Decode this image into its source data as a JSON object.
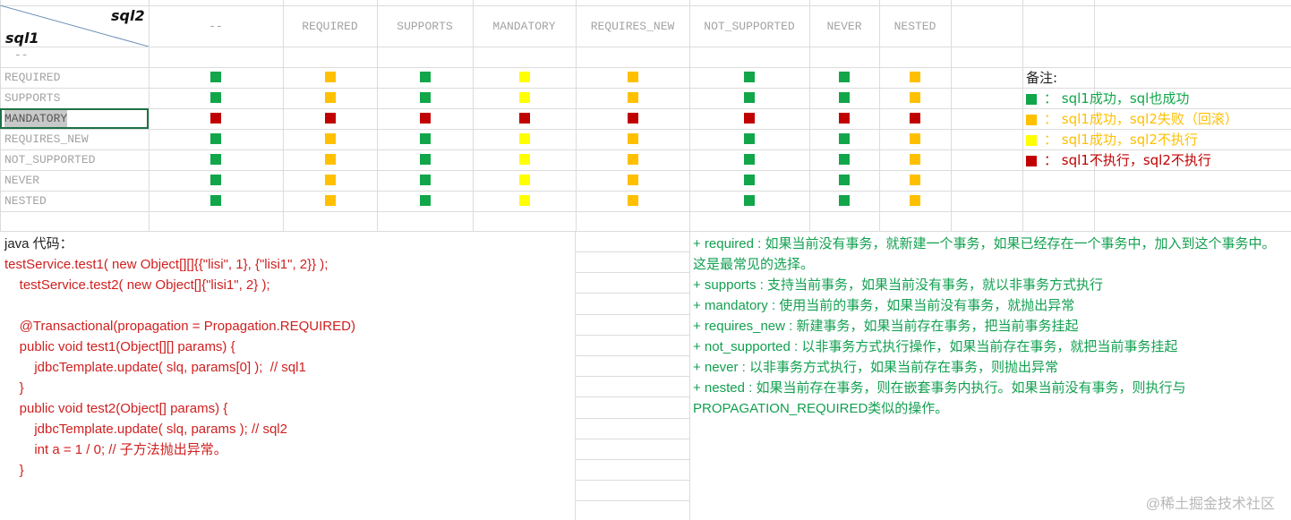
{
  "corner": {
    "col_axis": "sql2",
    "row_axis": "sql1"
  },
  "columns": [
    "--",
    "REQUIRED",
    "SUPPORTS",
    "MANDATORY",
    "REQUIRES_NEW",
    "NOT_SUPPORTED",
    "NEVER",
    "NESTED"
  ],
  "first_row_label": "--",
  "rows": [
    {
      "label": "REQUIRED",
      "cells": [
        "green",
        "orange",
        "green",
        "yellow",
        "orange",
        "green",
        "green",
        "orange"
      ]
    },
    {
      "label": "SUPPORTS",
      "cells": [
        "green",
        "orange",
        "green",
        "yellow",
        "orange",
        "green",
        "green",
        "orange"
      ]
    },
    {
      "label": "MANDATORY",
      "cells": [
        "red",
        "red",
        "red",
        "red",
        "red",
        "red",
        "red",
        "red"
      ]
    },
    {
      "label": "REQUIRES_NEW",
      "cells": [
        "green",
        "orange",
        "green",
        "yellow",
        "orange",
        "green",
        "green",
        "orange"
      ]
    },
    {
      "label": "NOT_SUPPORTED",
      "cells": [
        "green",
        "orange",
        "green",
        "yellow",
        "orange",
        "green",
        "green",
        "orange"
      ]
    },
    {
      "label": "NEVER",
      "cells": [
        "green",
        "orange",
        "green",
        "yellow",
        "orange",
        "green",
        "green",
        "orange"
      ]
    },
    {
      "label": "NESTED",
      "cells": [
        "green",
        "orange",
        "green",
        "yellow",
        "orange",
        "green",
        "green",
        "orange"
      ]
    }
  ],
  "colors": {
    "green": "#12a64a",
    "orange": "#ffc000",
    "yellow": "#ffff00",
    "red": "#c00000"
  },
  "legend": {
    "title": "备注:",
    "items": [
      {
        "color": "green",
        "text_color": "#12a64a",
        "text": "：  sql1成功，sql也成功"
      },
      {
        "color": "orange",
        "text_color": "#ffc000",
        "text": "：  sql1成功，sql2失败（回滚）"
      },
      {
        "color": "yellow",
        "text_color": "#ffc000",
        "text": "：  sql1成功，sql2不执行"
      },
      {
        "color": "red",
        "text_color": "#c00000",
        "text": "：  sql1不执行，sql2不执行"
      }
    ]
  },
  "code": {
    "title": "java 代码：",
    "lines": [
      "testService.test1( new Object[][]{{\"lisi\", 1}, {\"lisi1\", 2}} );",
      "    testService.test2( new Object[]{\"lisi1\", 2} );",
      "",
      "    @Transactional(propagation = Propagation.REQUIRED)",
      "    public void test1(Object[][] params) {",
      "        jdbcTemplate.update( slq, params[0] );  // sql1",
      "    }",
      "    public void test2(Object[] params) {",
      "        jdbcTemplate.update( slq, params ); // sql2",
      "        int a = 1 / 0; // 子方法抛出异常。",
      "    }"
    ]
  },
  "notes": [
    "  + required : 如果当前没有事务，就新建一个事务，如果已经存在一个事务中，加入到这个事务中。这是最常见的选择。",
    "  + supports : 支持当前事务，如果当前没有事务，就以非事务方式执行",
    "  + mandatory : 使用当前的事务，如果当前没有事务，就抛出异常",
    "  + requires_new : 新建事务，如果当前存在事务，把当前事务挂起",
    "  + not_supported : 以非事务方式执行操作，如果当前存在事务，就把当前事务挂起",
    "  + never : 以非事务方式执行，如果当前存在事务，则抛出异常",
    "  + nested : 如果当前存在事务，则在嵌套事务内执行。如果当前没有事务，则执行与PROPAGATION_REQUIRED类似的操作。"
  ],
  "watermark": "@稀土掘金技术社区"
}
